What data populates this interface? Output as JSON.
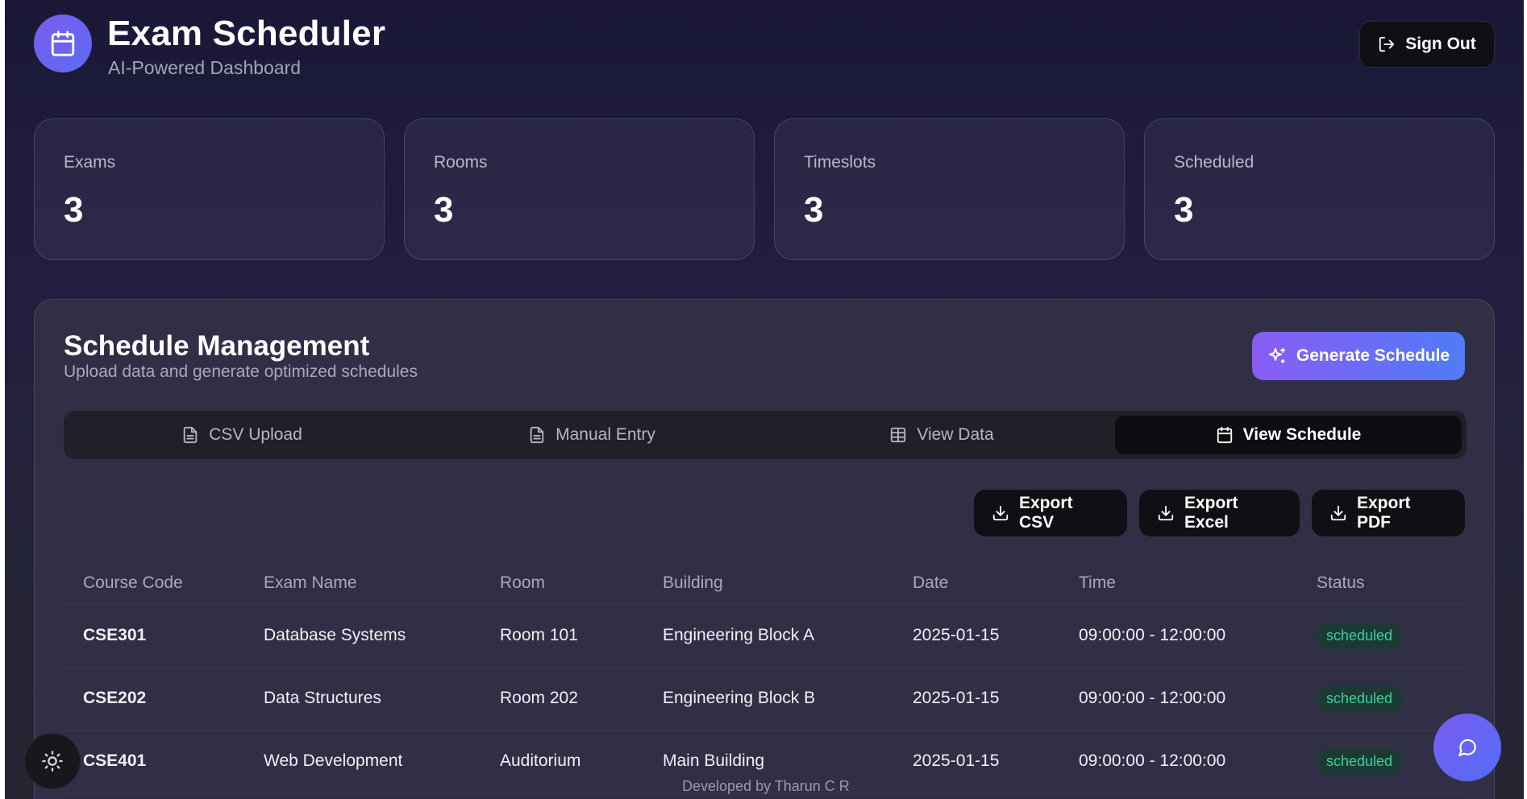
{
  "header": {
    "title": "Exam Scheduler",
    "subtitle": "AI-Powered Dashboard",
    "sign_out_label": "Sign Out"
  },
  "stats": [
    {
      "label": "Exams",
      "value": "3"
    },
    {
      "label": "Rooms",
      "value": "3"
    },
    {
      "label": "Timeslots",
      "value": "3"
    },
    {
      "label": "Scheduled",
      "value": "3"
    }
  ],
  "panel": {
    "title": "Schedule Management",
    "subtitle": "Upload data and generate optimized schedules",
    "generate_label": "Generate Schedule"
  },
  "tabs": [
    {
      "label": "CSV Upload",
      "icon": "file-text-icon"
    },
    {
      "label": "Manual Entry",
      "icon": "file-text-icon"
    },
    {
      "label": "View Data",
      "icon": "table-icon"
    },
    {
      "label": "View Schedule",
      "icon": "calendar-icon",
      "active": true
    }
  ],
  "exports": [
    {
      "label": "Export CSV",
      "icon": "download-icon"
    },
    {
      "label": "Export Excel",
      "icon": "download-icon"
    },
    {
      "label": "Export PDF",
      "icon": "download-icon"
    }
  ],
  "table": {
    "headers": [
      "Course Code",
      "Exam Name",
      "Room",
      "Building",
      "Date",
      "Time",
      "Status"
    ],
    "rows": [
      [
        "CSE301",
        "Database Systems",
        "Room 101",
        "Engineering Block A",
        "2025-01-15",
        "09:00:00 - 12:00:00",
        "scheduled"
      ],
      [
        "CSE202",
        "Data Structures",
        "Room 202",
        "Engineering Block B",
        "2025-01-15",
        "09:00:00 - 12:00:00",
        "scheduled"
      ],
      [
        "CSE401",
        "Web Development",
        "Auditorium",
        "Main Building",
        "2025-01-15",
        "09:00:00 - 12:00:00",
        "scheduled"
      ]
    ]
  },
  "footer": {
    "credit": "Developed by Tharun C R"
  },
  "colors": {
    "accent": "#7c5cf0",
    "status_scheduled": "#34d399"
  }
}
